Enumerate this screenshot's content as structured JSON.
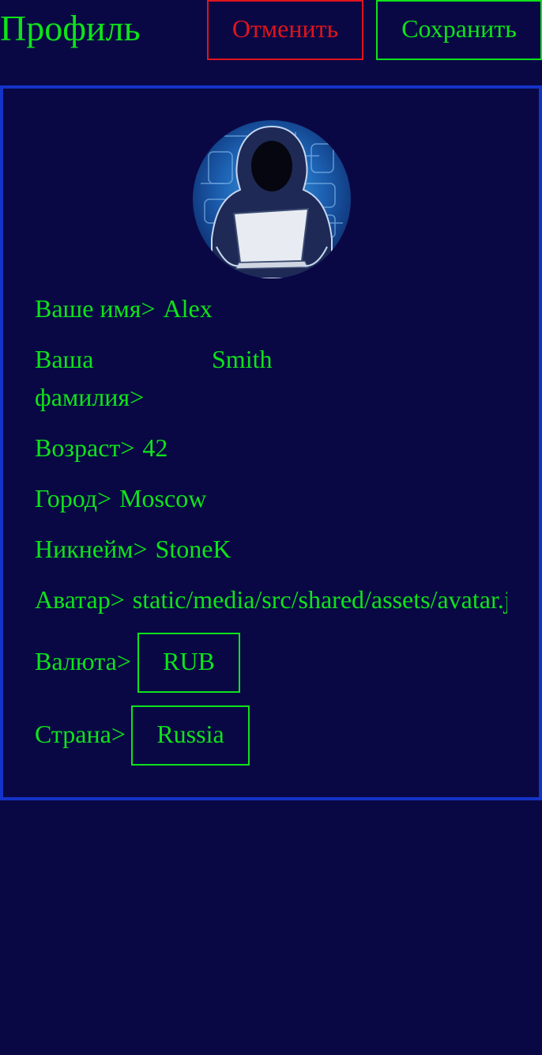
{
  "header": {
    "title": "Профиль",
    "cancel_label": "Отменить",
    "save_label": "Сохранить"
  },
  "profile": {
    "name_label": "Ваше имя>",
    "name_value": "Alex",
    "surname_label": "Ваша фамилия>",
    "surname_value": "Smith",
    "age_label": "Возраст>",
    "age_value": "42",
    "city_label": "Город>",
    "city_value": "Moscow",
    "nickname_label": "Никнейм>",
    "nickname_value": "StoneK",
    "avatar_label": "Аватар>",
    "avatar_value": "static/media/src/shared/assets/avatar.jpg",
    "currency_label": "Валюта>",
    "currency_value": "RUB",
    "country_label": "Страна>",
    "country_value": "Russia"
  },
  "colors": {
    "background": "#090845",
    "text": "#0ee31a",
    "cancel": "#e0141c",
    "card_border": "#1433c8"
  }
}
